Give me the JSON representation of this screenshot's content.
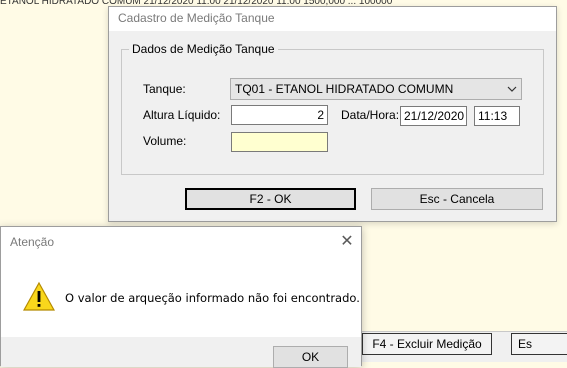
{
  "background": {
    "top_strip_text": "ETANOL HIDRATADO COMUM   21/12/2020  11:00   21/12/2020  11:00   1500,000   ...   100000",
    "bottom_buttons": [
      "F4 - Excluir Medição",
      "Es"
    ]
  },
  "dialog": {
    "title": "Cadastro de Medição Tanque",
    "close_glyph": "✕",
    "group_title": "Dados de Medição Tanque",
    "tanque_label": "Tanque:",
    "tanque_value": "TQ01 - ETANOL HIDRATADO COMUMN",
    "altura_label": "Altura Líquido:",
    "altura_value": "2",
    "datahora_label": "Data/Hora:",
    "data_value": "21/12/2020",
    "hora_value": "11:13",
    "volume_label": "Volume:",
    "volume_value": "",
    "ok_button": "F2 - OK",
    "cancel_button": "Esc - Cancela"
  },
  "alert": {
    "title": "Atenção",
    "close_glyph": "✕",
    "message": "O valor de arqueção informado não foi encontrado.",
    "ok_button": "OK",
    "icon": "warning-icon",
    "icon_color": "#f9d71c"
  }
}
